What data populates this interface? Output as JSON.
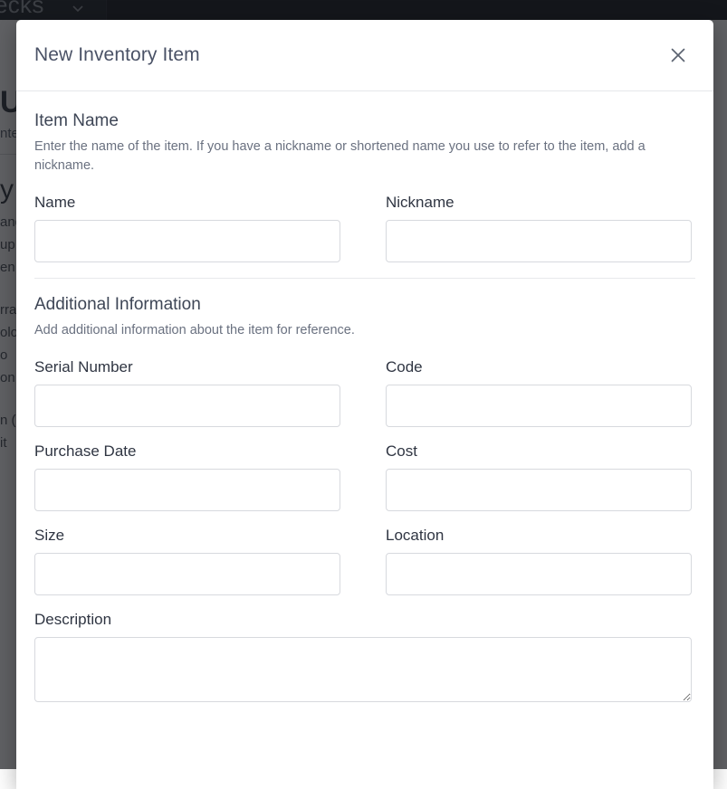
{
  "background": {
    "navbar": {
      "brand_text": "ecks",
      "chevron_icon": "chevron-down-icon"
    },
    "page": {
      "heading": "Ul",
      "subtext": "nte",
      "heading2": "y",
      "lines_top": [
        "and",
        "up",
        "en"
      ],
      "lines_mid": [
        "rra",
        "olo",
        "o",
        "on"
      ],
      "lines_bottom": [
        "n (",
        "it "
      ]
    }
  },
  "modal": {
    "title": "New Inventory Item",
    "close_icon": "close-icon",
    "close_label": "Close",
    "sections": [
      {
        "title": "Item Name",
        "description": "Enter the name of the item. If you have a nickname or shortened name you use to refer to the item, add a nickname."
      },
      {
        "title": "Additional Information",
        "description": "Add additional information about the item for reference."
      }
    ],
    "fields": {
      "name": {
        "label": "Name",
        "value": "",
        "placeholder": ""
      },
      "nickname": {
        "label": "Nickname",
        "value": "",
        "placeholder": ""
      },
      "serial_number": {
        "label": "Serial Number",
        "value": "",
        "placeholder": ""
      },
      "code": {
        "label": "Code",
        "value": "",
        "placeholder": ""
      },
      "purchase_date": {
        "label": "Purchase Date",
        "value": "",
        "placeholder": ""
      },
      "cost": {
        "label": "Cost",
        "value": "",
        "placeholder": ""
      },
      "size": {
        "label": "Size",
        "value": "",
        "placeholder": ""
      },
      "location": {
        "label": "Location",
        "value": "",
        "placeholder": ""
      },
      "description": {
        "label": "Description",
        "value": "",
        "placeholder": ""
      }
    }
  },
  "colors": {
    "title_text": "#4a5266",
    "label_text": "#2f3542",
    "muted_text": "#6a7180",
    "input_border": "#d7d9de",
    "divider": "#e8e9ec",
    "navbar_bg": "#14171c",
    "backdrop": "rgba(20,22,26,0.68)"
  }
}
